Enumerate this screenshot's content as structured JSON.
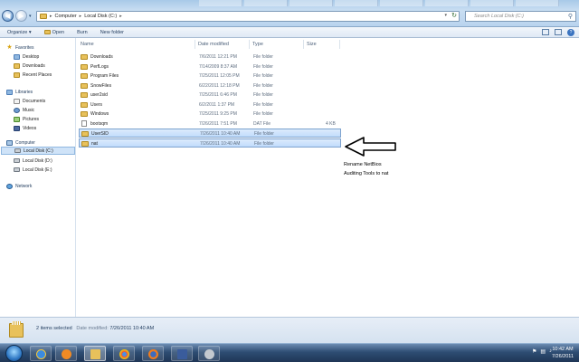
{
  "window": {
    "address": [
      "Computer",
      "Local Disk (C:)"
    ],
    "search_placeholder": "Search Local Disk (C:)"
  },
  "command_bar": {
    "organize": "Organize ▾",
    "open": "Open",
    "burn": "Burn",
    "new_folder": "New folder"
  },
  "navigation": {
    "favorites": {
      "label": "Favorites",
      "items": [
        "Desktop",
        "Downloads",
        "Recent Places"
      ]
    },
    "libraries": {
      "label": "Libraries",
      "items": [
        "Documents",
        "Music",
        "Pictures",
        "Videos"
      ]
    },
    "computer": {
      "label": "Computer",
      "items": [
        "Local Disk (C:)",
        "Local Disk (D:)",
        "Local Disk (E:)"
      ],
      "selected": "Local Disk (C:)"
    },
    "network": {
      "label": "Network"
    }
  },
  "columns": {
    "name": "Name",
    "date": "Date modified",
    "type": "Type",
    "size": "Size"
  },
  "files": [
    {
      "name": "Downloads",
      "date": "7/6/2011 12:21 PM",
      "type": "File folder",
      "size": "",
      "kind": "folder"
    },
    {
      "name": "PerfLogs",
      "date": "7/14/2009 8:37 AM",
      "type": "File folder",
      "size": "",
      "kind": "folder"
    },
    {
      "name": "Program Files",
      "date": "7/25/2011 12:05 PM",
      "type": "File folder",
      "size": "",
      "kind": "folder"
    },
    {
      "name": "SnowFiles",
      "date": "6/22/2011 12:18 PM",
      "type": "File folder",
      "size": "",
      "kind": "folder"
    },
    {
      "name": "user2sid",
      "date": "7/25/2011 6:46 PM",
      "type": "File folder",
      "size": "",
      "kind": "folder"
    },
    {
      "name": "Users",
      "date": "6/2/2011 1:37 PM",
      "type": "File folder",
      "size": "",
      "kind": "folder"
    },
    {
      "name": "Windows",
      "date": "7/25/2011 9:25 PM",
      "type": "File folder",
      "size": "",
      "kind": "folder"
    },
    {
      "name": "bootsqm",
      "date": "7/26/2011 7:51 PM",
      "type": "DAT File",
      "size": "4 KB",
      "kind": "file"
    },
    {
      "name": "UserSID",
      "date": "7/26/2011 10:40 AM",
      "type": "File folder",
      "size": "",
      "kind": "folder",
      "selected": true
    },
    {
      "name": "nat",
      "date": "7/26/2011 10:40 AM",
      "type": "File folder",
      "size": "",
      "kind": "folder",
      "selected": true
    }
  ],
  "annotation": {
    "line1": "Rename NetBios",
    "line2": "Auditing Tools to nat"
  },
  "details": {
    "count": "2 items selected",
    "label": "Date modified:",
    "value": "7/26/2011 10:40 AM"
  },
  "taskbar": {
    "time": "10:42 AM",
    "date": "7/26/2011"
  },
  "icons": {
    "back": "back-arrow-icon",
    "forward": "forward-arrow-icon",
    "search": "search-icon",
    "start": "windows-orb-icon",
    "folder": "folder-icon"
  },
  "colors": {
    "selection": "#c1dcfc",
    "chrome": "#b9d3ee",
    "taskbar": "#2e4d73",
    "folder": "#e8c15b"
  }
}
